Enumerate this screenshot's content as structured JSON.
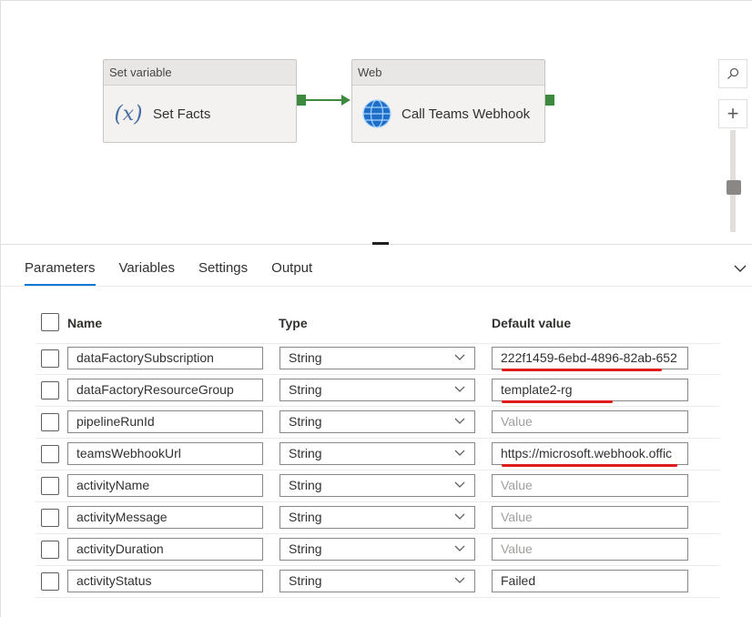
{
  "canvas": {
    "activities": [
      {
        "type_label": "Set variable",
        "name": "Set Facts",
        "icon": "variable-fx-icon"
      },
      {
        "type_label": "Web",
        "name": "Call Teams Webhook",
        "icon": "globe-icon"
      }
    ],
    "zoom": {
      "search_icon": "search-icon",
      "plus_label": "+"
    },
    "connector_color": "#3d8a3f"
  },
  "panel": {
    "tabs": [
      "Parameters",
      "Variables",
      "Settings",
      "Output"
    ],
    "active_tab": "Parameters",
    "columns": {
      "name": "Name",
      "type": "Type",
      "default": "Default value"
    },
    "rows": [
      {
        "name": "dataFactorySubscription",
        "type": "String",
        "default": "222f1459-6ebd-4896-82ab-652",
        "placeholder": ""
      },
      {
        "name": "dataFactoryResourceGroup",
        "type": "String",
        "default": "template2-rg",
        "placeholder": ""
      },
      {
        "name": "pipelineRunId",
        "type": "String",
        "default": "",
        "placeholder": "Value"
      },
      {
        "name": "teamsWebhookUrl",
        "type": "String",
        "default": "https://microsoft.webhook.offic",
        "placeholder": ""
      },
      {
        "name": "activityName",
        "type": "String",
        "default": "",
        "placeholder": "Value"
      },
      {
        "name": "activityMessage",
        "type": "String",
        "default": "",
        "placeholder": "Value"
      },
      {
        "name": "activityDuration",
        "type": "String",
        "default": "",
        "placeholder": "Value"
      },
      {
        "name": "activityStatus",
        "type": "String",
        "default": "Failed",
        "placeholder": ""
      }
    ],
    "accent_color": "#0078d4",
    "highlight_color": "#e01b1b"
  }
}
